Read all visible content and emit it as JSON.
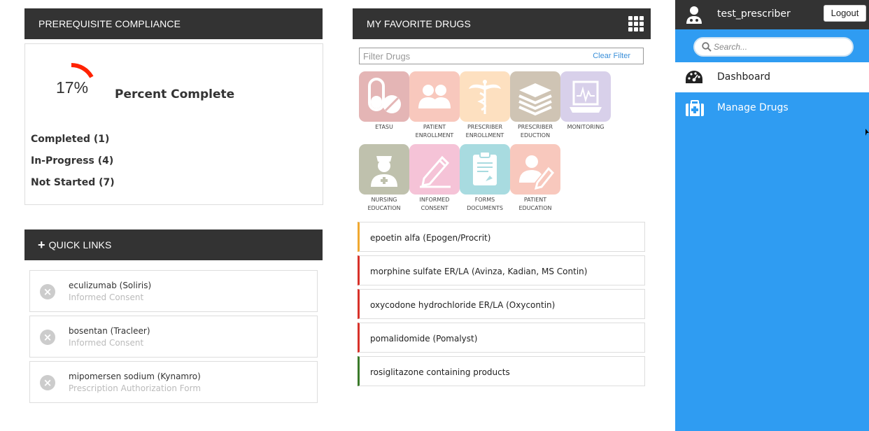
{
  "compliance": {
    "title": "PREREQUISITE COMPLIANCE",
    "percent_value": 17,
    "percent_text": "17%",
    "percent_label": "Percent Complete",
    "completed": "Completed (1)",
    "in_progress": "In-Progress (4)",
    "not_started": "Not Started (7)",
    "arc_color": "#ff2200"
  },
  "quick_links": {
    "title": "QUICK LINKS",
    "plus": "+",
    "items": [
      {
        "name": "eculizumab (Soliris)",
        "sub": "Informed Consent"
      },
      {
        "name": "bosentan (Tracleer)",
        "sub": "Informed Consent"
      },
      {
        "name": "mipomersen sodium (Kynamro)",
        "sub": "Prescription Authorization Form"
      }
    ],
    "remove_glyph": "×"
  },
  "favorites": {
    "title": "MY FAVORITE DRUGS",
    "filter_placeholder": "Filter Drugs",
    "filter_value": "",
    "clear_label": "Clear Filter",
    "tiles": [
      {
        "label": "ETASU",
        "icon": "pill-icon",
        "color": "#e4b5b5"
      },
      {
        "label": "PATIENT ENROLLMENT",
        "icon": "people-icon",
        "color": "#f8c8bd"
      },
      {
        "label": "PRESCRIBER ENROLLMENT",
        "icon": "caduceus-icon",
        "color": "#fde0c0"
      },
      {
        "label": "PRESCRIBER EDUCTION",
        "icon": "books-icon",
        "color": "#cfc4b4"
      },
      {
        "label": "MONITORING",
        "icon": "monitor-icon",
        "color": "#d8d0ea"
      },
      {
        "label": "NURSING EDUCATION",
        "icon": "nurse-icon",
        "color": "#bfc1ad"
      },
      {
        "label": "INFORMED CONSENT",
        "icon": "pencil-icon",
        "color": "#f5c3d7"
      },
      {
        "label": "FORMS DOCUMENTS",
        "icon": "forms-icon",
        "color": "#a8dbe0"
      },
      {
        "label": "PATIENT EDUCATION",
        "icon": "patient-edit-icon",
        "color": "#f8c8bd"
      }
    ],
    "drugs": [
      {
        "name": "epoetin alfa (Epogen/Procrit)",
        "color": "#f0a830"
      },
      {
        "name": "morphine sulfate ER/LA (Avinza, Kadian, MS Contin)",
        "color": "#d8322a"
      },
      {
        "name": "oxycodone hydrochloride ER/LA (Oxycontin)",
        "color": "#d8322a"
      },
      {
        "name": "pomalidomide (Pomalyst)",
        "color": "#d8322a"
      },
      {
        "name": "rosiglitazone containing products",
        "color": "#3a7a2a"
      }
    ]
  },
  "sidebar": {
    "username": "test_prescriber",
    "logout_label": "Logout",
    "search_placeholder": "Search...",
    "search_value": "",
    "nav": [
      {
        "label": "Dashboard",
        "icon": "dashboard-icon"
      },
      {
        "label": "Manage Drugs",
        "icon": "medkit-icon"
      }
    ],
    "accent": "#2f9cf2"
  }
}
